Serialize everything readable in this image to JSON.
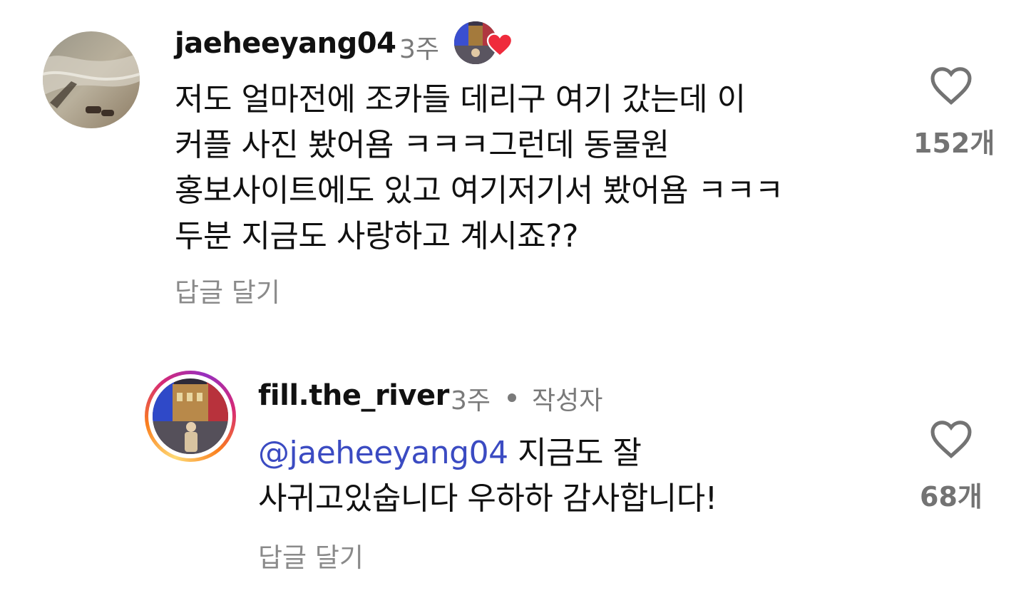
{
  "comments": [
    {
      "username": "jaeheeyang04",
      "time": "3주",
      "text_lines": [
        "저도 얼마전에 조카들 데리구 여기 갔는데 이",
        "커플 사진 봤어욤 ㅋㅋㅋ그런데 동물원",
        "홍보사이트에도 있고 여기저기서 봤어욤 ㅋㅋㅋ",
        "두분 지금도 사랑하고 계시죠??"
      ],
      "reply_label": "답글 달기",
      "like_count": "152개",
      "author_liked": true
    },
    {
      "username": "fill.the_river",
      "time": "3주",
      "author_label": "작성자",
      "mention": "@jaeheeyang04",
      "text_after_mention": " 지금도 잘",
      "text_line2": "사귀고있숩니다 우하하 감사합니다!",
      "reply_label": "답글 달기",
      "like_count": "68개"
    }
  ],
  "icons": {
    "like": "heart-outline-icon",
    "creator_like": "heart-filled-icon"
  },
  "colors": {
    "mention": "#3b4bc2",
    "heart_red": "#ef2b3c",
    "muted_text": "#7a7a7a"
  }
}
